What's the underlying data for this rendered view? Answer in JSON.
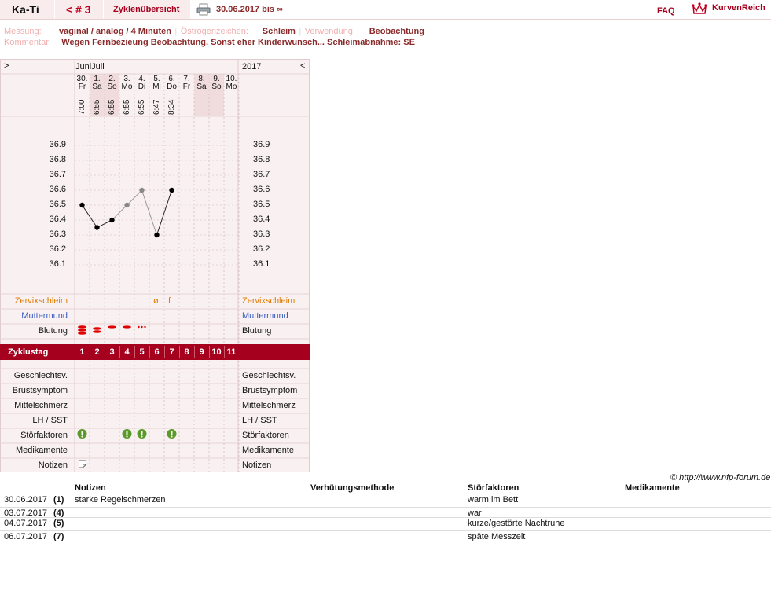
{
  "header": {
    "user": "Ka-Ti",
    "cycle_nav": "< # 3",
    "overview": "Zyklenübersicht",
    "print_icon": "printer-icon",
    "range": "30.06.2017 bis ∞",
    "faq": "FAQ",
    "brand": "KurvenReich",
    "logo_icon": "crown-icon"
  },
  "info": {
    "messung_label": "Messung:",
    "messung_value": "vaginal / analog / 4 Minuten",
    "oestrogen_label": "Östrogenzeichen:",
    "oestrogen_value": "Schleim",
    "verwendung_label": "Verwendung:",
    "verwendung_value": "Beobachtung",
    "kommentar_label": "Kommentar:",
    "kommentar_value": "Wegen Fernbezieung Beobachtung. Sonst eher Kinderwunsch... Schleimabnahme: SE"
  },
  "chart_nav": {
    "prev": ">",
    "next": "<",
    "month": "JuniJuli",
    "year": "2017"
  },
  "days": [
    {
      "num": "30.",
      "wd": "Fr",
      "time": "7:00",
      "weekend": false
    },
    {
      "num": "1.",
      "wd": "Sa",
      "time": "6:55",
      "weekend": true
    },
    {
      "num": "2.",
      "wd": "So",
      "time": "6:55",
      "weekend": true
    },
    {
      "num": "3.",
      "wd": "Mo",
      "time": "6:55",
      "weekend": false
    },
    {
      "num": "4.",
      "wd": "Di",
      "time": "6:55",
      "weekend": false
    },
    {
      "num": "5.",
      "wd": "Mi",
      "time": "6:47",
      "weekend": false
    },
    {
      "num": "6.",
      "wd": "Do",
      "time": "8:34",
      "weekend": false
    },
    {
      "num": "7.",
      "wd": "Fr",
      "time": "",
      "weekend": false
    },
    {
      "num": "8.",
      "wd": "Sa",
      "time": "",
      "weekend": true
    },
    {
      "num": "9.",
      "wd": "So",
      "time": "",
      "weekend": true
    },
    {
      "num": "10.",
      "wd": "Mo",
      "time": "",
      "weekend": false
    }
  ],
  "temp_axis": [
    "36.9",
    "36.8",
    "36.7",
    "36.6",
    "36.5",
    "36.4",
    "36.3",
    "36.2",
    "36.1"
  ],
  "rows": {
    "zervix": "Zervixschleim",
    "muttermund": "Muttermund",
    "blutung": "Blutung",
    "zyklustag": "Zyklustag",
    "geschlechtsv": "Geschlechtsv.",
    "brustsymptom": "Brustsymptom",
    "mittelschmerz": "Mittelschmerz",
    "lh": "LH / SST",
    "stoerfaktoren": "Störfaktoren",
    "medikamente": "Medikamente",
    "notizen": "Notizen"
  },
  "zyklustage": [
    "1",
    "2",
    "3",
    "4",
    "5",
    "6",
    "7",
    "8",
    "9",
    "10",
    "11"
  ],
  "zervix_marks": [
    {
      "day": 5,
      "sym": "ø"
    },
    {
      "day": 6,
      "sym": "f"
    }
  ],
  "blutung_levels": [
    4,
    3,
    2,
    2,
    1
  ],
  "stoer_days": [
    0,
    3,
    4,
    6
  ],
  "notiz_days": [
    0
  ],
  "chart_data": {
    "type": "line",
    "ylim": [
      36.0,
      37.0
    ],
    "points": [
      {
        "day": 0,
        "temp": 36.5,
        "kind": "valid"
      },
      {
        "day": 1,
        "temp": 36.35,
        "kind": "valid"
      },
      {
        "day": 2,
        "temp": 36.4,
        "kind": "valid"
      },
      {
        "day": 3,
        "temp": 36.5,
        "kind": "disturbed"
      },
      {
        "day": 4,
        "temp": 36.6,
        "kind": "disturbed"
      },
      {
        "day": 5,
        "temp": 36.3,
        "kind": "valid"
      },
      {
        "day": 6,
        "temp": 36.6,
        "kind": "valid"
      }
    ]
  },
  "copyright": "© http://www.nfp-forum.de",
  "notes_table": {
    "headers": [
      "Notizen",
      "Verhütungsmethode",
      "Störfaktoren",
      "Medikamente"
    ],
    "rows": [
      {
        "date": "30.06.2017",
        "day": "(1)",
        "note": "starke Regelschmerzen",
        "method": "",
        "stoer": "warm im Bett",
        "med": ""
      },
      {
        "date": "03.07.2017",
        "day": "(4)",
        "note": "",
        "method": "",
        "stoer": "war",
        "med": ""
      },
      {
        "date": "04.07.2017",
        "day": "(5)",
        "note": "",
        "method": "",
        "stoer": "kurze/gestörte Nachtruhe",
        "med": ""
      },
      {
        "date": "06.07.2017",
        "day": "(7)",
        "note": "",
        "method": "",
        "stoer": "späte Messzeit",
        "med": ""
      }
    ]
  },
  "colors": {
    "accent": "#a5001e",
    "zervix": "#e07a00",
    "muttermund": "#3a5bbf",
    "blood": "#e00000",
    "warn": "#5a9a2a"
  }
}
